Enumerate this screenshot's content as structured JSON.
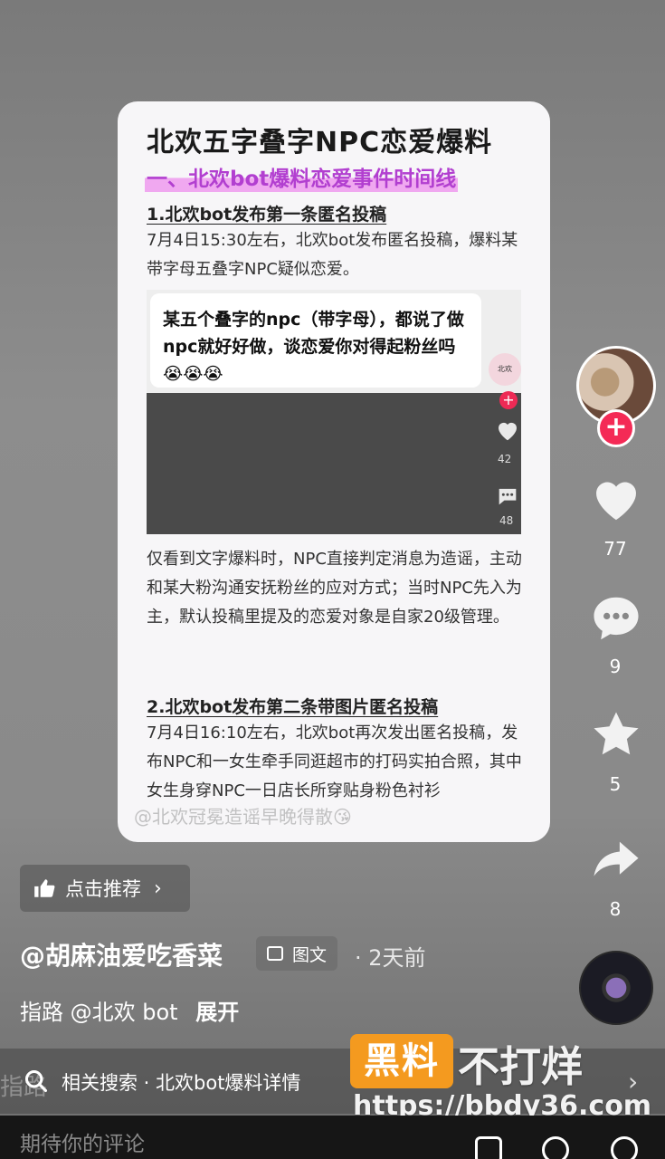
{
  "post_card": {
    "title": "北欢五字叠字NPC恋爱爆料",
    "section_heading": "一、北欢bot爆料恋爱事件时间线",
    "sub1": "1.北欢bot发布第一条匿名投稿",
    "para1": "7月4日15:30左右，北欢bot发布匿名投稿，爆料某带字母五叠字NPC疑似恋爱。",
    "inner_shot": {
      "bubble_text": "某五个叠字的npc（带字母），都说了做npc就好好做，谈恋爱你对得起粉丝吗😭😭😭",
      "avatar_text": "北欢",
      "like_count": "42",
      "comment_count": "48"
    },
    "para2": "仅看到文字爆料时，NPC直接判定消息为造谣，主动和某大粉沟通安抚粉丝的应对方式；当时NPC先入为主，默认投稿里提及的恋爱对象是自家20级管理。",
    "sub2": "2.北欢bot发布第二条带图片匿名投稿",
    "para3": "7月4日16:10左右，北欢bot再次发出匿名投稿，发布NPC和一女生牵手同逛超市的打码实拍合照，其中女生身穿NPC一日店长所穿贴身粉色衬衫",
    "watermark": "@北欢冠冕造谣早晚得散😘"
  },
  "rail": {
    "like_count": "77",
    "comment_count": "9",
    "favorite_count": "5",
    "share_count": "8"
  },
  "recommend_label": "点击推荐",
  "author": "@胡麻油爱吃香菜",
  "post_type_tag": "图文",
  "time_ago": "· 2天前",
  "caption": {
    "text": "指路 @北欢 bot",
    "expand": "展开"
  },
  "related_search": {
    "ghost": "指路",
    "label": "相关搜索 · 北欢bot爆料详情"
  },
  "brand": {
    "logo": "黑料",
    "name": "不打烊",
    "url": "https://bbdy36.com"
  },
  "comment_placeholder": "期待你的评论"
}
